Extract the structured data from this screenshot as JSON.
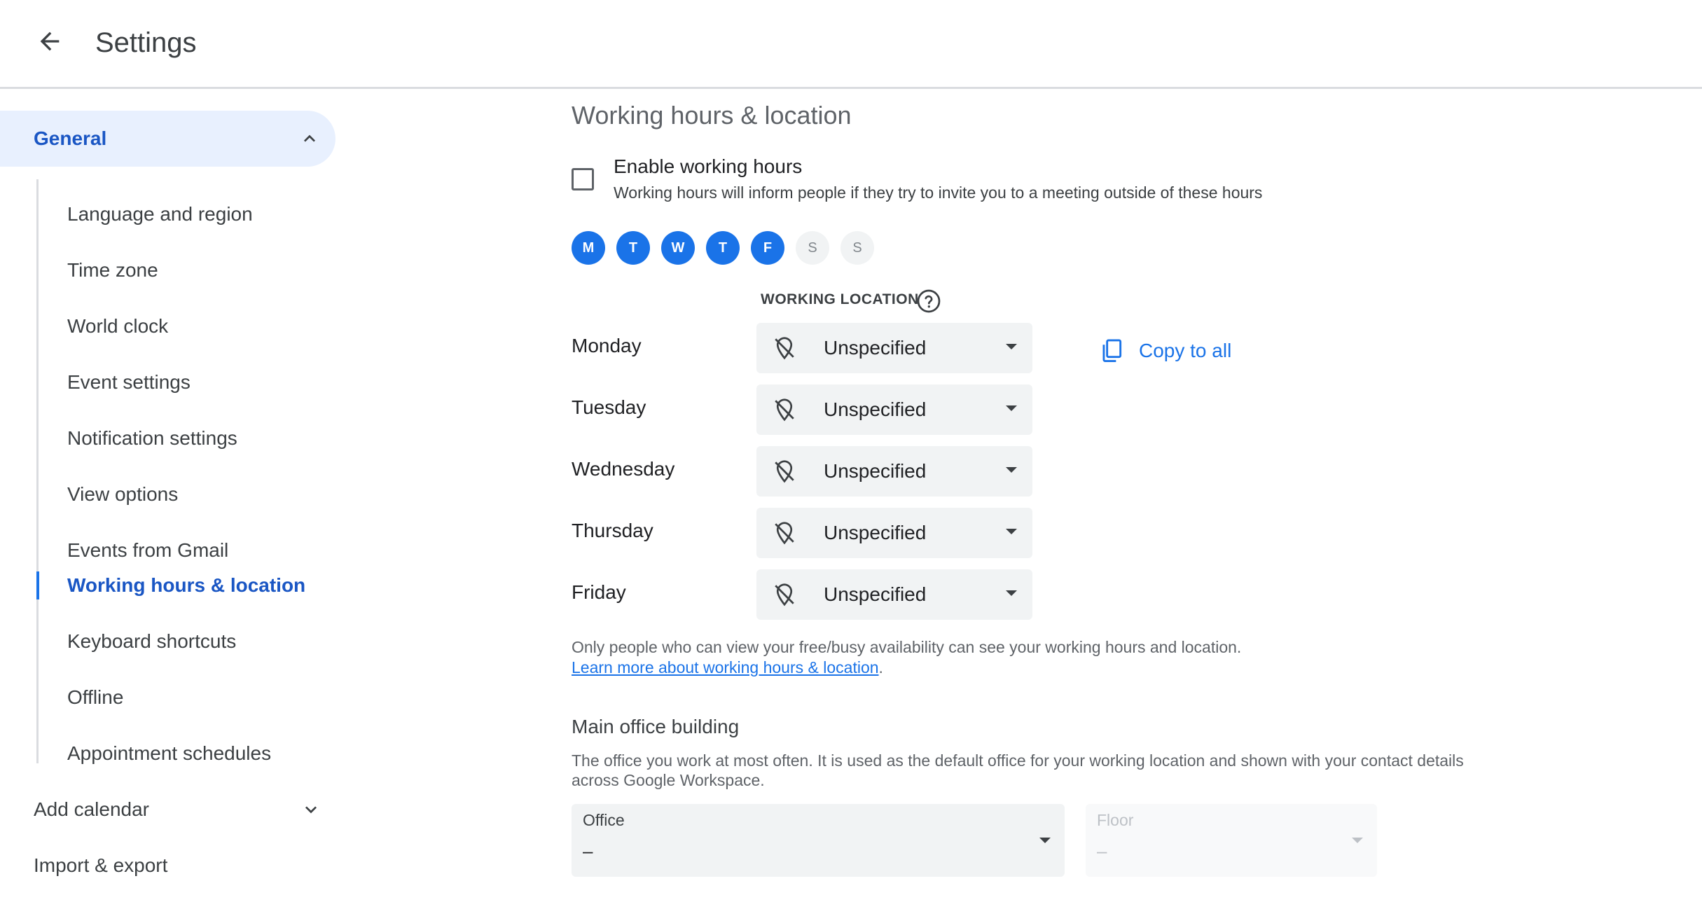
{
  "header": {
    "title": "Settings",
    "back_icon": "arrow-back-icon"
  },
  "sidebar": {
    "general": {
      "label": "General",
      "expanded": true
    },
    "items": [
      {
        "label": "Language and region"
      },
      {
        "label": "Time zone"
      },
      {
        "label": "World clock"
      },
      {
        "label": "Event settings"
      },
      {
        "label": "Notification settings"
      },
      {
        "label": "View options"
      },
      {
        "label": "Events from Gmail"
      },
      {
        "label": "Working hours & location",
        "active": true
      },
      {
        "label": "Keyboard shortcuts"
      },
      {
        "label": "Offline"
      },
      {
        "label": "Appointment schedules"
      }
    ],
    "add_calendar": {
      "label": "Add calendar",
      "expanded": false
    },
    "import_export": {
      "label": "Import & export"
    }
  },
  "main": {
    "section_title": "Working hours & location",
    "enable": {
      "label": "Enable working hours",
      "description": "Working hours will inform people if they try to invite you to a meeting outside of these hours",
      "checked": false
    },
    "days": [
      {
        "letter": "M",
        "selected": true
      },
      {
        "letter": "T",
        "selected": true
      },
      {
        "letter": "W",
        "selected": true
      },
      {
        "letter": "T",
        "selected": true
      },
      {
        "letter": "F",
        "selected": true
      },
      {
        "letter": "S",
        "selected": false
      },
      {
        "letter": "S",
        "selected": false
      }
    ],
    "working_location_heading": "WORKING LOCATION",
    "rows": [
      {
        "day": "Monday",
        "value": "Unspecified"
      },
      {
        "day": "Tuesday",
        "value": "Unspecified"
      },
      {
        "day": "Wednesday",
        "value": "Unspecified"
      },
      {
        "day": "Thursday",
        "value": "Unspecified"
      },
      {
        "day": "Friday",
        "value": "Unspecified"
      }
    ],
    "copy_to_all": "Copy to all",
    "note": {
      "text": "Only people who can view your free/busy availability can see your working hours and location.",
      "link": "Learn more about working hours & location",
      "link_suffix": "."
    },
    "office_building": {
      "title": "Main office building",
      "description": "The office you work at most often. It is used as the default office for your working location and shown with your contact details across Google Workspace.",
      "office": {
        "label": "Office",
        "value": "–"
      },
      "floor": {
        "label": "Floor",
        "value": "–",
        "disabled": true
      }
    }
  },
  "colors": {
    "accent": "#1a73e8",
    "active_text": "#1a56c4",
    "active_bg": "#e8f0fe",
    "field_bg": "#f1f3f4"
  }
}
